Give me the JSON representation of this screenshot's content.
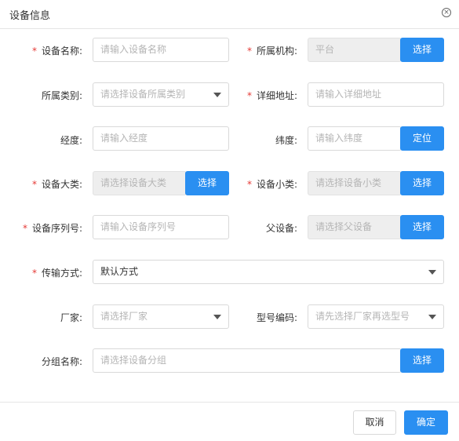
{
  "dialog": {
    "title": "设备信息",
    "close_icon": "×"
  },
  "form": {
    "required_mark": "*",
    "device_name": {
      "label": "设备名称:",
      "placeholder": "请输入设备名称"
    },
    "org": {
      "label": "所属机构:",
      "value": "平台",
      "button": "选择"
    },
    "category": {
      "label": "所属类别:",
      "placeholder": "请选择设备所属类别"
    },
    "address": {
      "label": "详细地址:",
      "placeholder": "请输入详细地址"
    },
    "longitude": {
      "label": "经度:",
      "placeholder": "请输入经度"
    },
    "latitude": {
      "label": "纬度:",
      "placeholder": "请输入纬度",
      "button": "定位"
    },
    "big_class": {
      "label": "设备大类:",
      "placeholder": "请选择设备大类",
      "button": "选择"
    },
    "small_class": {
      "label": "设备小类:",
      "placeholder": "请选择设备小类",
      "button": "选择"
    },
    "serial": {
      "label": "设备序列号:",
      "placeholder": "请输入设备序列号"
    },
    "parent": {
      "label": "父设备:",
      "placeholder": "请选择父设备",
      "button": "选择"
    },
    "transport": {
      "label": "传输方式:",
      "value": "默认方式"
    },
    "vendor": {
      "label": "厂家:",
      "placeholder": "请选择厂家"
    },
    "model": {
      "label": "型号编码:",
      "placeholder": "请先选择厂家再选型号"
    },
    "group": {
      "label": "分组名称:",
      "placeholder": "请选择设备分组",
      "button": "选择"
    }
  },
  "footer": {
    "cancel": "取消",
    "ok": "确定"
  }
}
